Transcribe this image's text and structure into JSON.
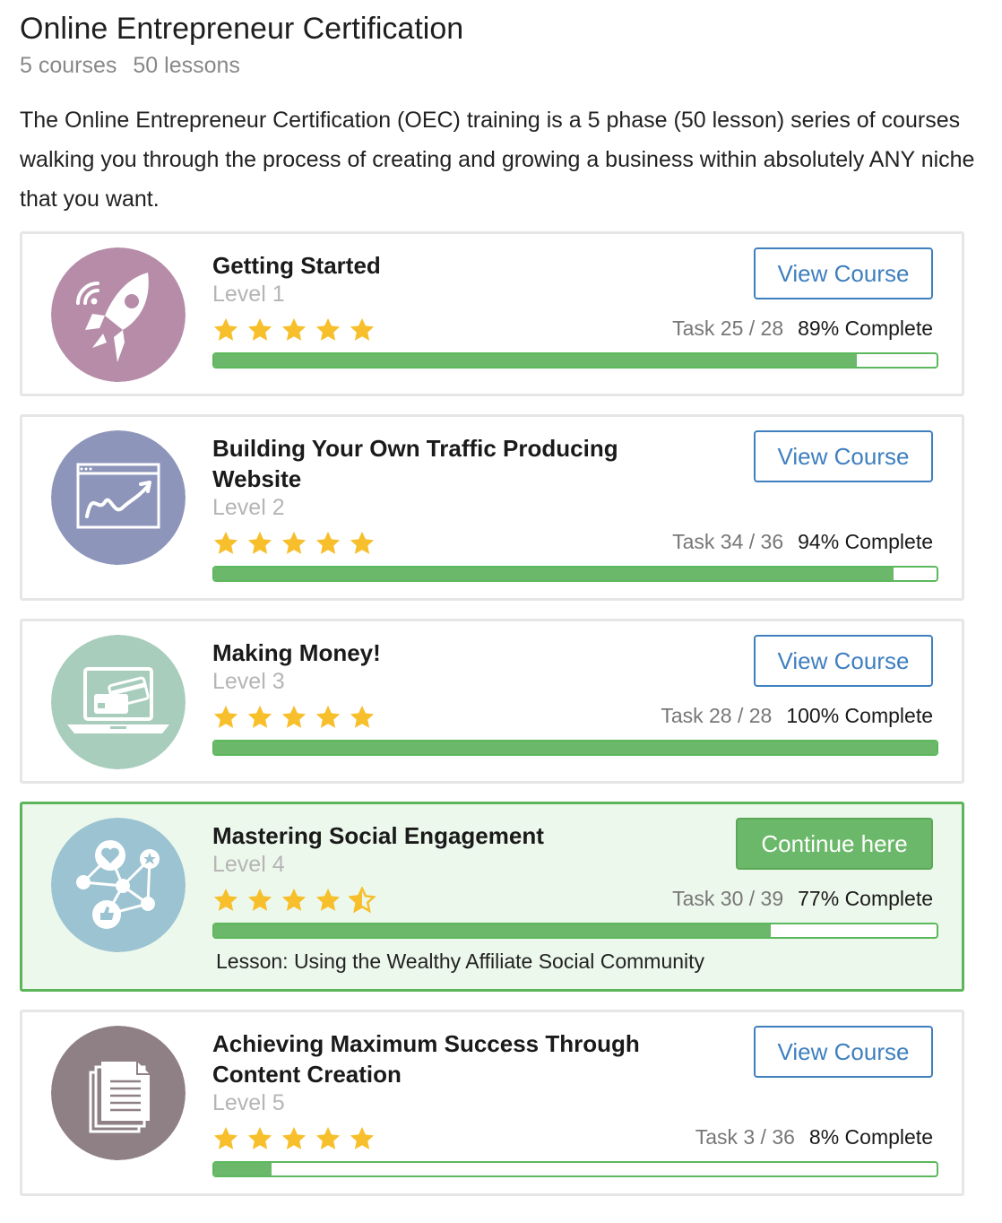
{
  "page": {
    "title": "Online Entrepreneur Certification",
    "courses_count": "5 courses",
    "lessons_count": "50 lessons",
    "intro": "The Online Entrepreneur Certification (OEC) training is a 5 phase (50 lesson) series of courses walking you through the process of creating and growing a business within absolutely ANY niche that you want."
  },
  "colors": {
    "accent_blue": "#3f7fbf",
    "progress_green": "#6cb86a",
    "active_bg": "#edf8ec",
    "star": "#f6bf2b"
  },
  "courses": [
    {
      "title": "Getting Started",
      "level": "Level 1",
      "rating": 5,
      "task_label": "Task 25 / 28",
      "percent_label": "89% Complete",
      "progress": 0.89,
      "button": "View Course",
      "icon": "rocket-icon",
      "icon_color": "#b68ca8"
    },
    {
      "title": "Building Your Own Traffic Producing Website",
      "level": "Level 2",
      "rating": 5,
      "task_label": "Task 34 / 36",
      "percent_label": "94% Complete",
      "progress": 0.94,
      "button": "View Course",
      "icon": "website-chart-icon",
      "icon_color": "#8d95ba"
    },
    {
      "title": "Making Money!",
      "level": "Level 3",
      "rating": 5,
      "task_label": "Task 28 / 28",
      "percent_label": "100% Complete",
      "progress": 1.0,
      "button": "View Course",
      "icon": "laptop-credit-card-icon",
      "icon_color": "#a8cdbd"
    },
    {
      "title": "Mastering Social Engagement",
      "level": "Level 4",
      "rating": 4.5,
      "task_label": "Task 30 / 39",
      "percent_label": "77% Complete",
      "progress": 0.77,
      "button": "Continue here",
      "lesson": "Lesson: Using the Wealthy Affiliate Social Community",
      "icon": "social-network-icon",
      "icon_color": "#9bc3d2"
    },
    {
      "title": "Achieving Maximum Success Through Content Creation",
      "level": "Level 5",
      "rating": 5,
      "task_label": "Task 3 / 36",
      "percent_label": "8% Complete",
      "progress": 0.08,
      "button": "View Course",
      "icon": "documents-icon",
      "icon_color": "#8f8086"
    }
  ]
}
